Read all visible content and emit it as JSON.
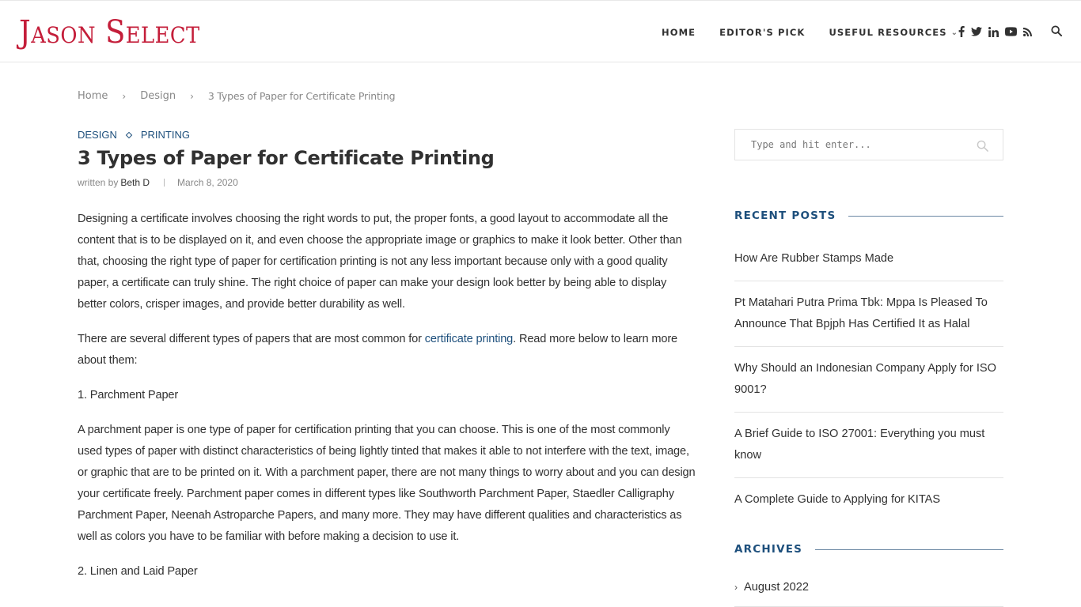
{
  "site": {
    "logo": "Jason Select",
    "brand_color": "#c41e3a",
    "accent_color": "#1d4f7c"
  },
  "nav": {
    "items": [
      {
        "label": "HOME"
      },
      {
        "label": "EDITOR'S PICK"
      },
      {
        "label": "USEFUL RESOURCES"
      }
    ],
    "dropdown_icon": "chevron-down-icon",
    "social_icons": [
      "facebook-icon",
      "twitter-icon",
      "linkedin-icon",
      "youtube-icon",
      "rss-icon"
    ],
    "search_icon": "search-icon"
  },
  "breadcrumb": {
    "items": [
      "Home",
      "Design",
      "3 Types of Paper for Certificate Printing"
    ],
    "separator_icon": "chevron-right-icon"
  },
  "post": {
    "categories": [
      "DESIGN",
      "PRINTING"
    ],
    "title": "3 Types of Paper for Certificate Printing",
    "written_by": "written by",
    "author": "Beth D",
    "date": "March 8, 2020",
    "paragraphs": {
      "p1": "Designing a certificate involves choosing the right words to put, the proper fonts, a good layout to accommodate all the content that is to be displayed on it, and even choose the appropriate image or graphics to make it look better. Other than that, choosing the right type of paper for certification printing is not any less important because only with a good quality paper, a certificate can truly shine. The right choice of paper can make your design look better by being able to display better colors, crisper images, and provide better durability as well.",
      "p2_before": "There are several different types of papers that are most common for ",
      "p2_link": "certificate printing",
      "p2_after": ". Read more below to learn more about them:",
      "h1": "1. Parchment Paper",
      "p3": "A parchment paper is one type of paper for certification printing that you can choose. This is one of the most commonly used types of paper with distinct characteristics of being lightly tinted that makes it able to not interfere with the text, image, or graphic that are to be printed on it. With a parchment paper, there are not many things to worry about and you can design your certificate freely. Parchment paper comes in different types like Southworth Parchment Paper, Staedler Calligraphy Parchment Paper, Neenah Astroparche Papers, and many more. They may have different qualities and characteristics as well as colors you have to be familiar with before making a decision to use it.",
      "h2": "2. Linen and Laid Paper"
    }
  },
  "sidebar": {
    "search": {
      "placeholder": "Type and hit enter..."
    },
    "recent_posts": {
      "title": "RECENT POSTS",
      "items": [
        "How Are Rubber Stamps Made",
        "Pt Matahari Putra Prima Tbk: Mppa Is Pleased To Announce That Bpjph Has Certified It as Halal",
        "Why Should an Indonesian Company Apply for ISO 9001?",
        "A Brief Guide to ISO 27001: Everything you must know",
        "A Complete Guide to Applying for KITAS"
      ]
    },
    "archives": {
      "title": "ARCHIVES",
      "items": [
        "August 2022"
      ]
    }
  }
}
